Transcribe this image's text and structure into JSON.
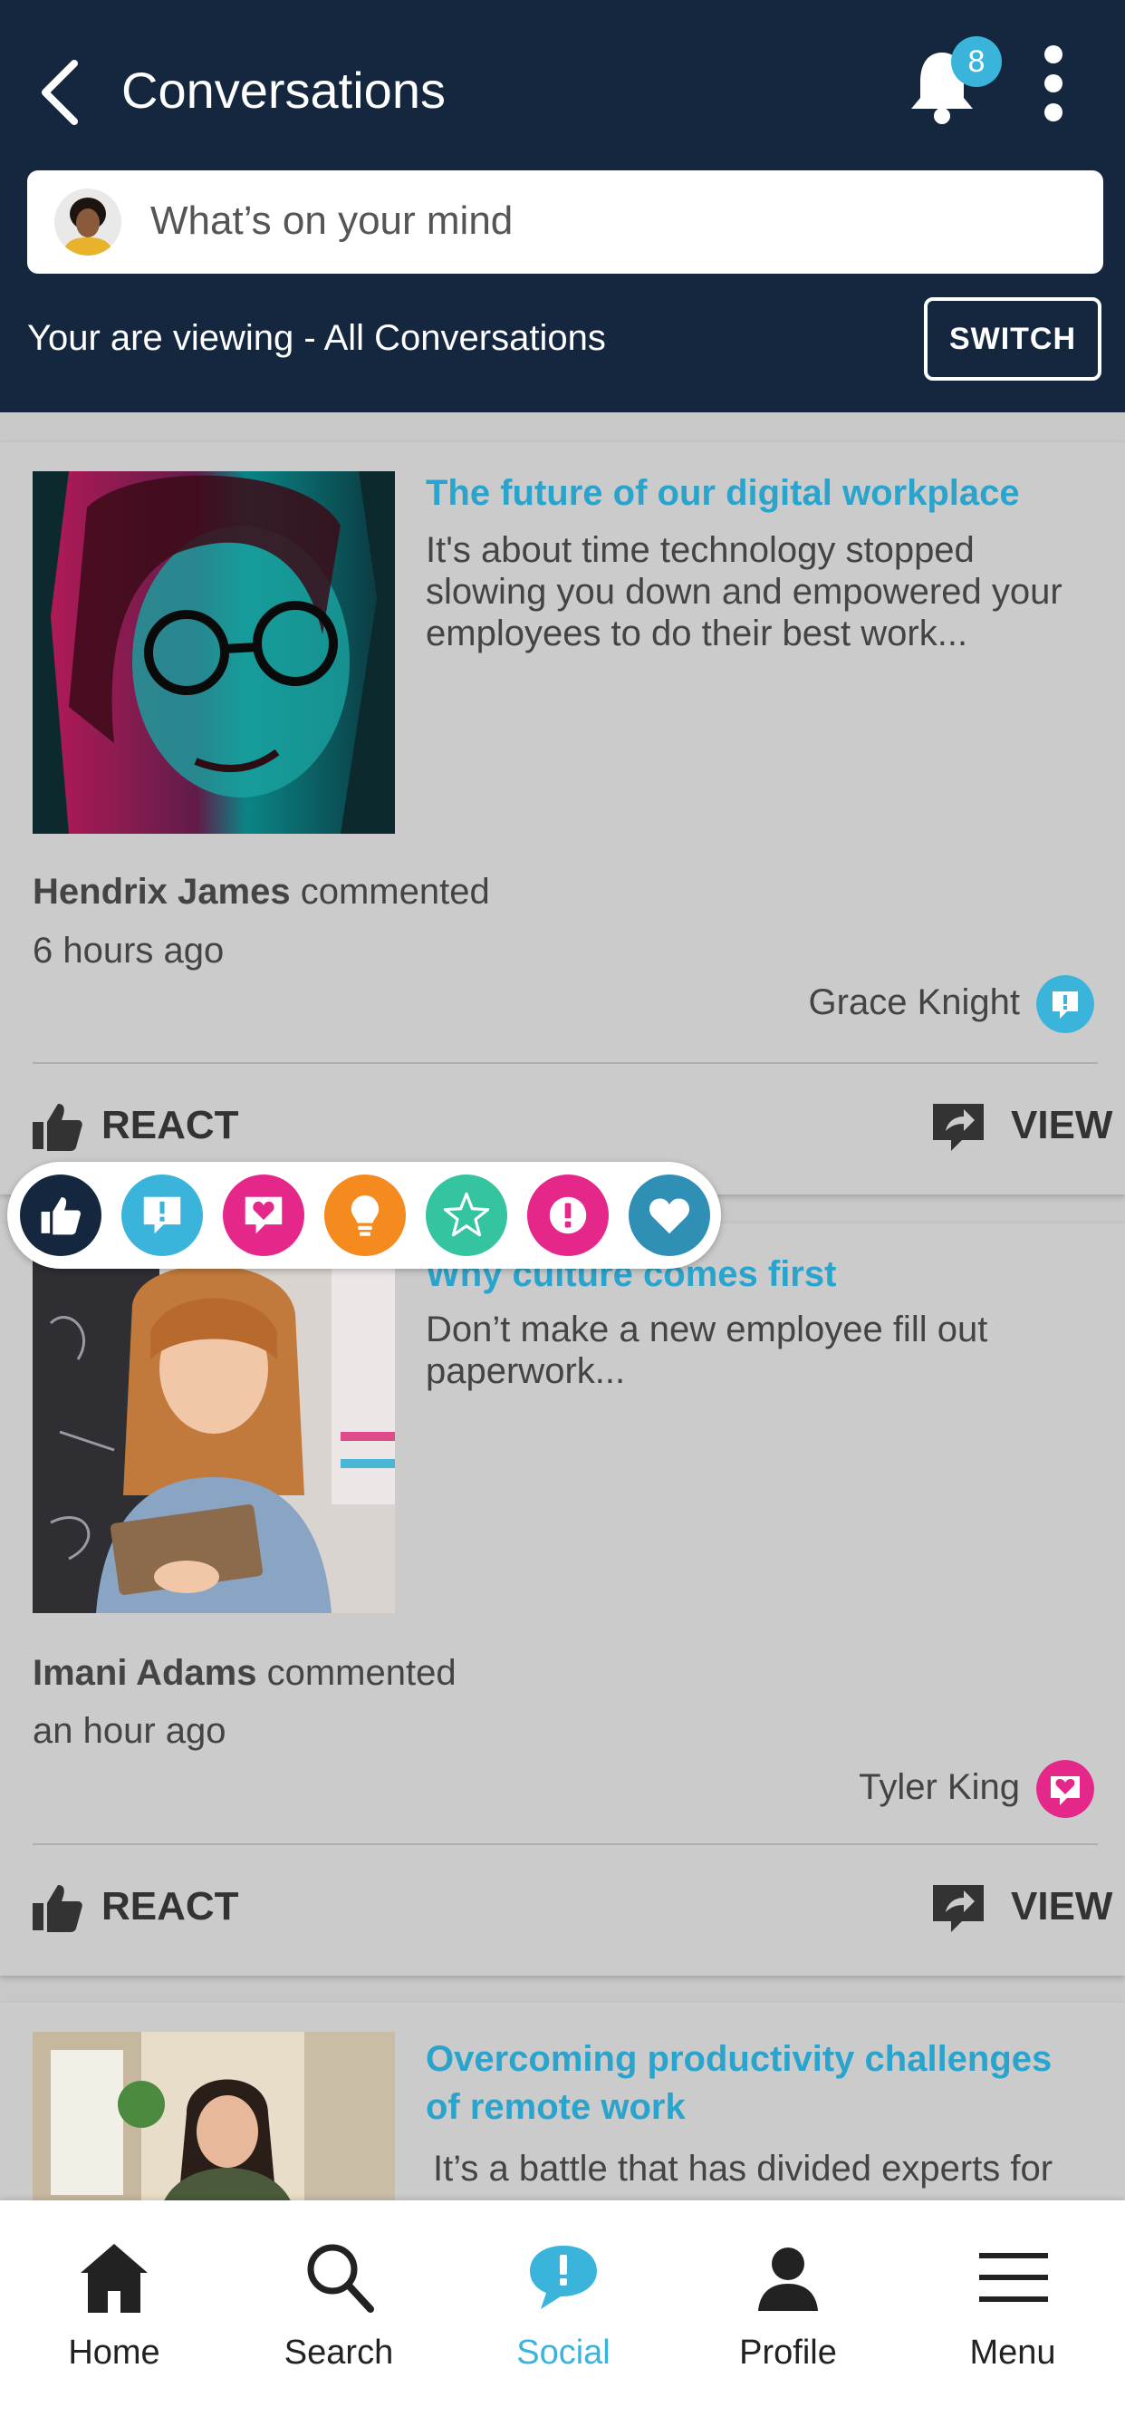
{
  "header": {
    "title": "Conversations",
    "notification_count": "8",
    "composer_placeholder": "What’s on your mind",
    "viewing_text": "Your are viewing - All Conversations",
    "switch_label": "SWITCH"
  },
  "posts": [
    {
      "title": "The future of our digital workplace",
      "body": "It's about time technology stopped slowing you down and empowered your employees to do their best work...",
      "commenter": "Hendrix James",
      "commented_suffix": " commented",
      "time": "6 hours ago",
      "tag_name": "Grace Knight",
      "tag_icon": "speech-bubble-alert-icon",
      "react_label": "REACT",
      "view_label": "VIEW"
    },
    {
      "title": "Why culture comes first",
      "body": "Don’t make a new employee fill out paperwork...",
      "commenter": "Imani Adams",
      "commented_suffix": " commented",
      "time": "an hour ago",
      "tag_name": "Tyler King",
      "tag_icon": "heart-bubble-icon",
      "react_label": "REACT",
      "view_label": "VIEW"
    },
    {
      "title": "Overcoming productivity challenges of remote work",
      "body": "It’s a battle that has divided experts for"
    }
  ],
  "reactions": [
    {
      "name": "thumbs-up-icon",
      "color": "#14273f"
    },
    {
      "name": "alert-bubble-icon",
      "color": "#3bb4dc"
    },
    {
      "name": "heart-bubble-icon",
      "color": "#e6278a"
    },
    {
      "name": "lightbulb-icon",
      "color": "#f58a1f"
    },
    {
      "name": "star-icon",
      "color": "#35c4a0"
    },
    {
      "name": "exclamation-icon",
      "color": "#e6278a"
    },
    {
      "name": "heart-icon",
      "color": "#2f8fb5"
    }
  ],
  "nav": [
    {
      "label": "Home",
      "icon": "home-icon"
    },
    {
      "label": "Search",
      "icon": "search-icon"
    },
    {
      "label": "Social",
      "icon": "social-bubble-icon",
      "active": true
    },
    {
      "label": "Profile",
      "icon": "profile-icon"
    },
    {
      "label": "Menu",
      "icon": "menu-icon"
    }
  ],
  "colors": {
    "header_bg": "#14273f",
    "accent": "#3bb4dc",
    "link_title": "#2aa4cc",
    "nav_active": "#3bb4dc"
  }
}
